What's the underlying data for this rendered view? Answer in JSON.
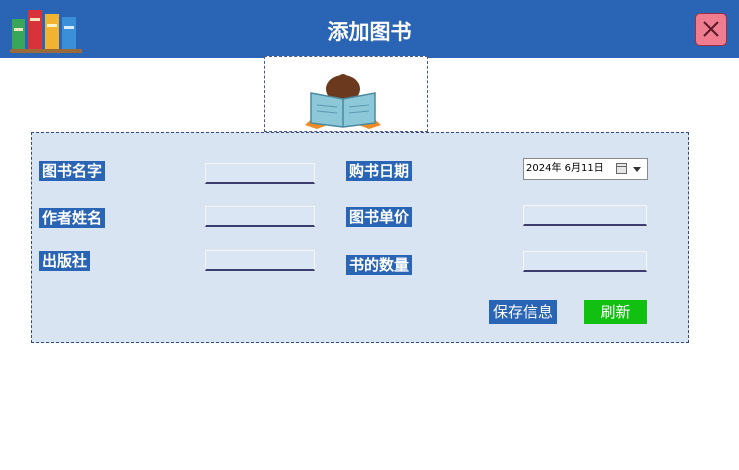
{
  "window": {
    "title": "添加图书"
  },
  "form": {
    "book_name_label": "图书名字",
    "author_label": "作者姓名",
    "publisher_label": "出版社",
    "purchase_date_label": "购书日期",
    "unit_price_label": "图书单价",
    "quantity_label": "书的数量",
    "purchase_date_value": "2024年  6月11日",
    "book_name_value": "",
    "author_value": "",
    "publisher_value": "",
    "unit_price_value": "",
    "quantity_value": ""
  },
  "buttons": {
    "save": "保存信息",
    "refresh": "刷新"
  },
  "colors": {
    "titlebar": "#2a64b4",
    "panel": "#d9e4f3",
    "label_bg": "#2a64b4",
    "refresh_button": "#12c012",
    "close_button": "#f07c90"
  },
  "icons": {
    "logo": "books-icon",
    "close": "close-icon",
    "illustration": "person-reading-icon",
    "date_dropdown": "calendar-dropdown-icon"
  }
}
